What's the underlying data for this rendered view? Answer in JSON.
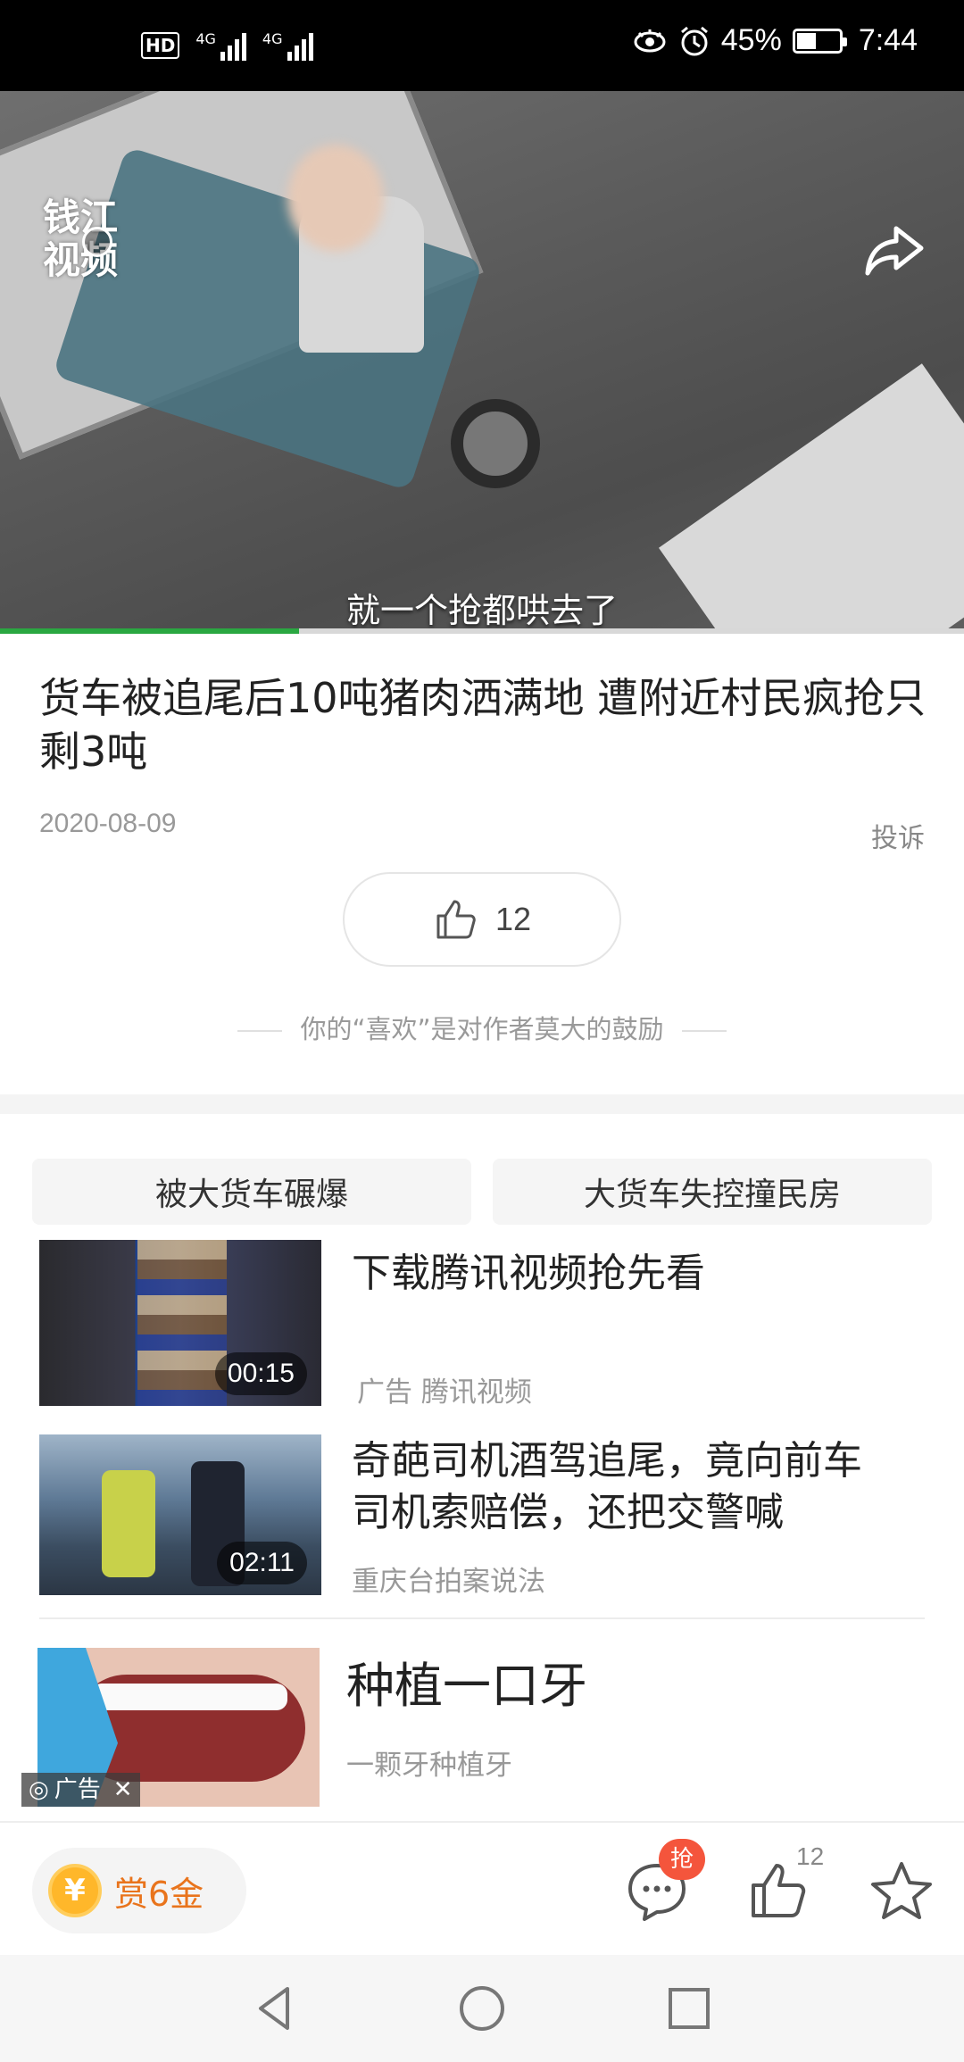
{
  "status_bar": {
    "hd_label": "HD",
    "sim1_label": "4G",
    "sim2_label": "4G",
    "battery_text": "45%",
    "battery_level": 0.45,
    "time": "7:44"
  },
  "video": {
    "channel_logo_text": "钱江视频",
    "subtitle": "就一个抢都哄去了",
    "progress": 0.31
  },
  "article": {
    "title": "货车被追尾后10吨猪肉洒满地 遭附近村民疯抢只剩3吨",
    "date": "2020-08-09",
    "report_label": "投诉",
    "like_count": "12",
    "encourage_text": "你的“喜欢”是对作者莫大的鼓励"
  },
  "related_tags": [
    "被大货车碾爆",
    "大货车失控撞民房"
  ],
  "feed": [
    {
      "title": "下载腾讯视频抢先看",
      "meta": "广告 腾讯视频",
      "duration": "00:15"
    },
    {
      "title": "奇葩司机酒驾追尾，竟向前车司机索赔偿，还把交警喊",
      "meta": "重庆台拍案说法",
      "duration": "02:11"
    },
    {
      "title": "种植一口牙",
      "meta": "一颗牙种植牙",
      "ad_label": "广告"
    }
  ],
  "action_bar": {
    "coin_symbol": "¥",
    "reward_label": "赏6金",
    "grab_badge": "抢",
    "like_count": "12"
  },
  "colors": {
    "accent_green": "#2aa741",
    "reward_orange": "#e9741c",
    "badge_red": "#f4553c"
  }
}
